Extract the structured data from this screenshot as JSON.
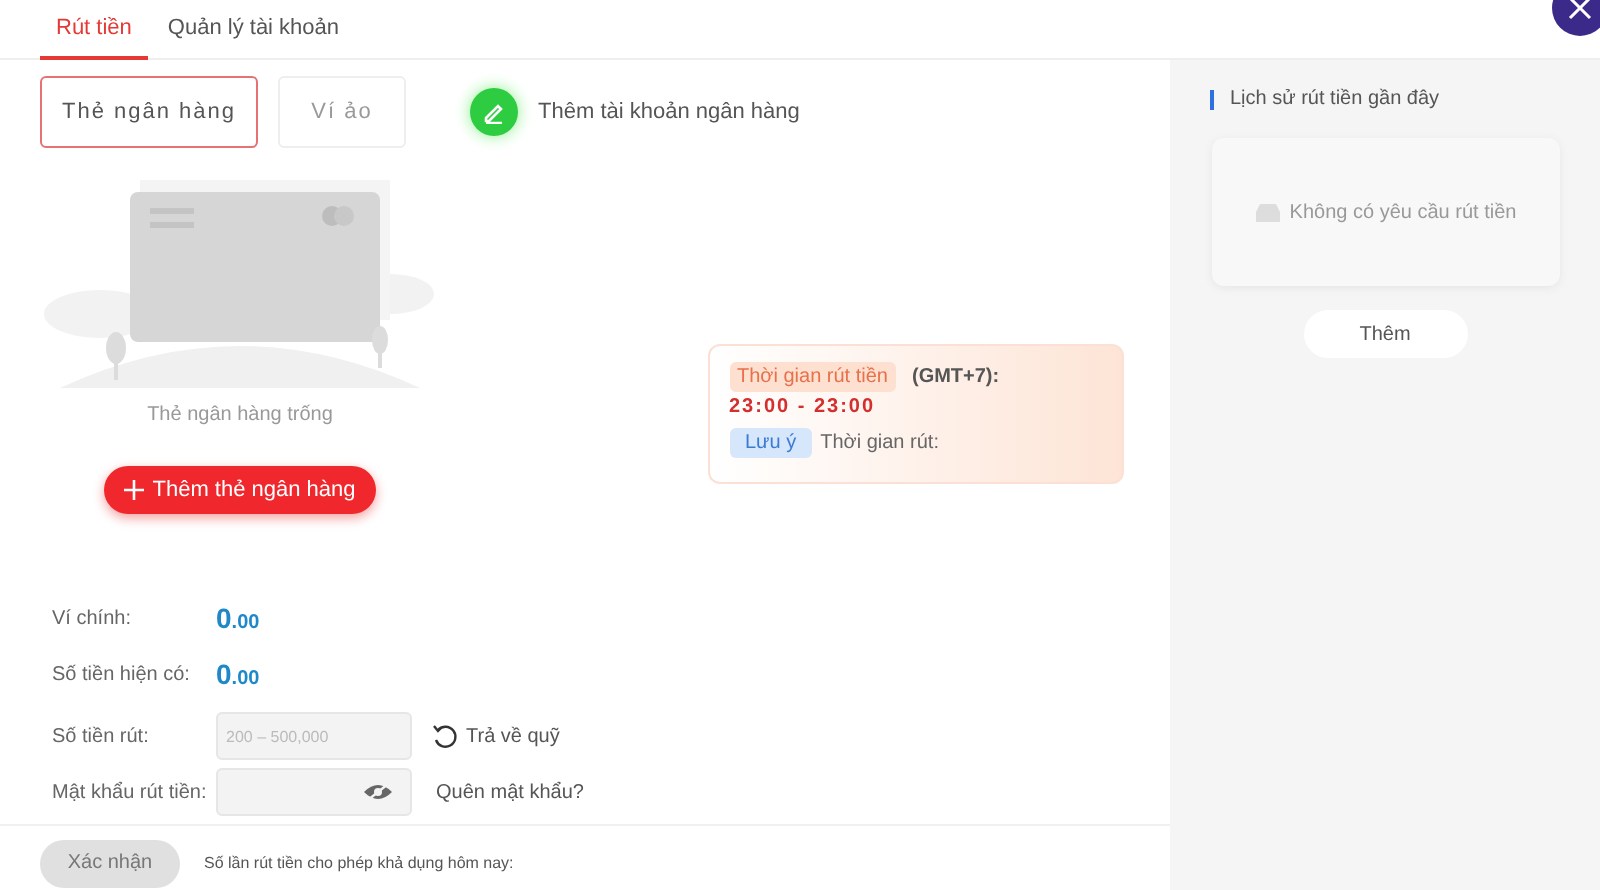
{
  "tabs": [
    {
      "label": "Rút tiền",
      "selected": true
    },
    {
      "label": "Quản lý tài khoản",
      "selected": false
    }
  ],
  "account_types": [
    {
      "label": "Thẻ ngân hàng",
      "selected": true
    },
    {
      "label": "Ví ảo",
      "selected": false
    }
  ],
  "add_account_link": "Thêm tài khoản ngân hàng",
  "empty_state": {
    "text": "Thẻ ngân hàng trống",
    "button": "Thêm thẻ ngân hàng"
  },
  "withdraw_time": {
    "tag": "Thời gian rút tiền",
    "timezone": "(GMT+7):",
    "time": "23:00 - 23:00",
    "note_tag": "Lưu ý",
    "note": "Thời gian rút:"
  },
  "balances": [
    {
      "label": "Ví chính:",
      "integer": "0",
      "decimal": ".00"
    },
    {
      "label": "Số tiền hiện có:",
      "integer": "0",
      "decimal": ".00"
    }
  ],
  "amount_field": {
    "label": "Số tiền rút:",
    "placeholder": "200 – 500,000",
    "link": "Trả về quỹ"
  },
  "password_field": {
    "label": "Mật khẩu rút tiền:",
    "link": "Quên mật khẩu?"
  },
  "submit": {
    "label": "Xác nhận",
    "disabled": true
  },
  "limit_text": "Số lần rút tiền cho phép khả dụng hôm nay:",
  "history": {
    "title": "Lịch sử rút tiền gần đây",
    "empty": "Không có yêu cầu rút tiền",
    "more": "Thêm"
  }
}
